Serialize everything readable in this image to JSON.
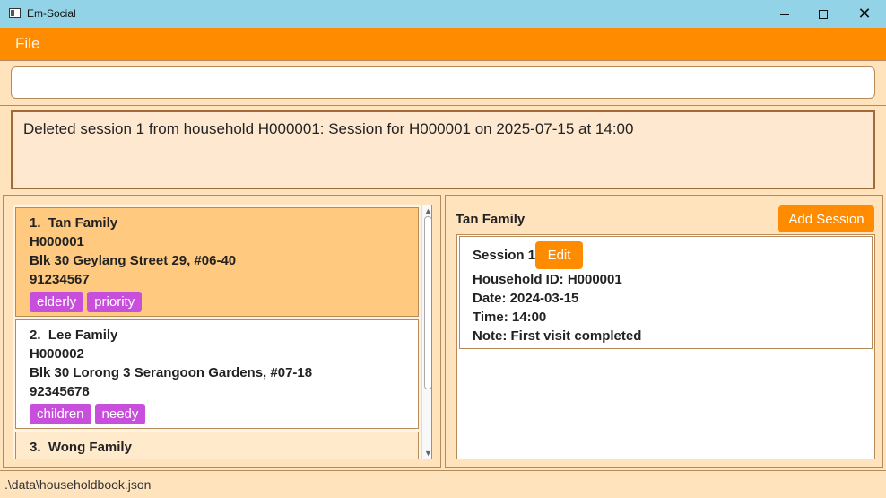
{
  "window": {
    "title": "Em-Social"
  },
  "menu": {
    "file": "File"
  },
  "command": {
    "value": "",
    "placeholder": ""
  },
  "result": {
    "text": "Deleted session 1 from household H000001: Session for H000001 on 2025-07-15 at 14:00"
  },
  "households": [
    {
      "index": "1.",
      "name": "Tan Family",
      "id": "H000001",
      "address": "Blk 30 Geylang Street 29, #06-40",
      "phone": "91234567",
      "tags": [
        "elderly",
        "priority"
      ]
    },
    {
      "index": "2.",
      "name": "Lee Family",
      "id": "H000002",
      "address": "Blk 30 Lorong 3 Serangoon Gardens, #07-18",
      "phone": "92345678",
      "tags": [
        "children",
        "needy"
      ]
    },
    {
      "index": "3.",
      "name": "Wong Family"
    }
  ],
  "detail": {
    "title": "Tan Family",
    "add_session_label": "Add Session",
    "session": {
      "title": "Session 1",
      "edit_label": "Edit",
      "household_id": "Household ID: H000001",
      "date": "Date: 2024-03-15",
      "time": "Time: 14:00",
      "note": "Note: First visit completed"
    }
  },
  "status": {
    "path": ".\\data\\householdbook.json"
  },
  "colors": {
    "accent": "#ff8c00",
    "tag": "#c84fdc",
    "titlebar": "#93d3e8",
    "selected": "#ffc97f"
  },
  "icons": {
    "app": "app-window-icon",
    "minimize": "minimize-icon",
    "maximize": "maximize-icon",
    "close": "close-icon"
  }
}
